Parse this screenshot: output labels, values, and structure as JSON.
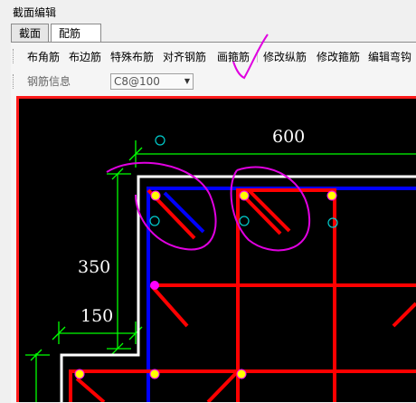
{
  "window": {
    "title": "截面编辑"
  },
  "tabs": [
    {
      "label": "截面",
      "active": false
    },
    {
      "label": "配筋",
      "active": true
    }
  ],
  "toolbar": {
    "buttons": [
      "布角筋",
      "布边筋",
      "特殊布筋",
      "对齐钢筋",
      "画箍筋",
      "修改纵筋",
      "修改箍筋",
      "编辑弯钩"
    ]
  },
  "rebar_info": {
    "label": "钢筋信息",
    "value": "C8@100"
  },
  "drawing": {
    "dimensions": {
      "top_width": "600",
      "left_height": "350",
      "offset": "150"
    },
    "colors": {
      "background": "#000000",
      "stirrup": "#ff0000",
      "outline": "#ffffff",
      "dimension": "#00ff00",
      "annotation": "#e000e0",
      "inner_line": "#0000ff"
    }
  }
}
